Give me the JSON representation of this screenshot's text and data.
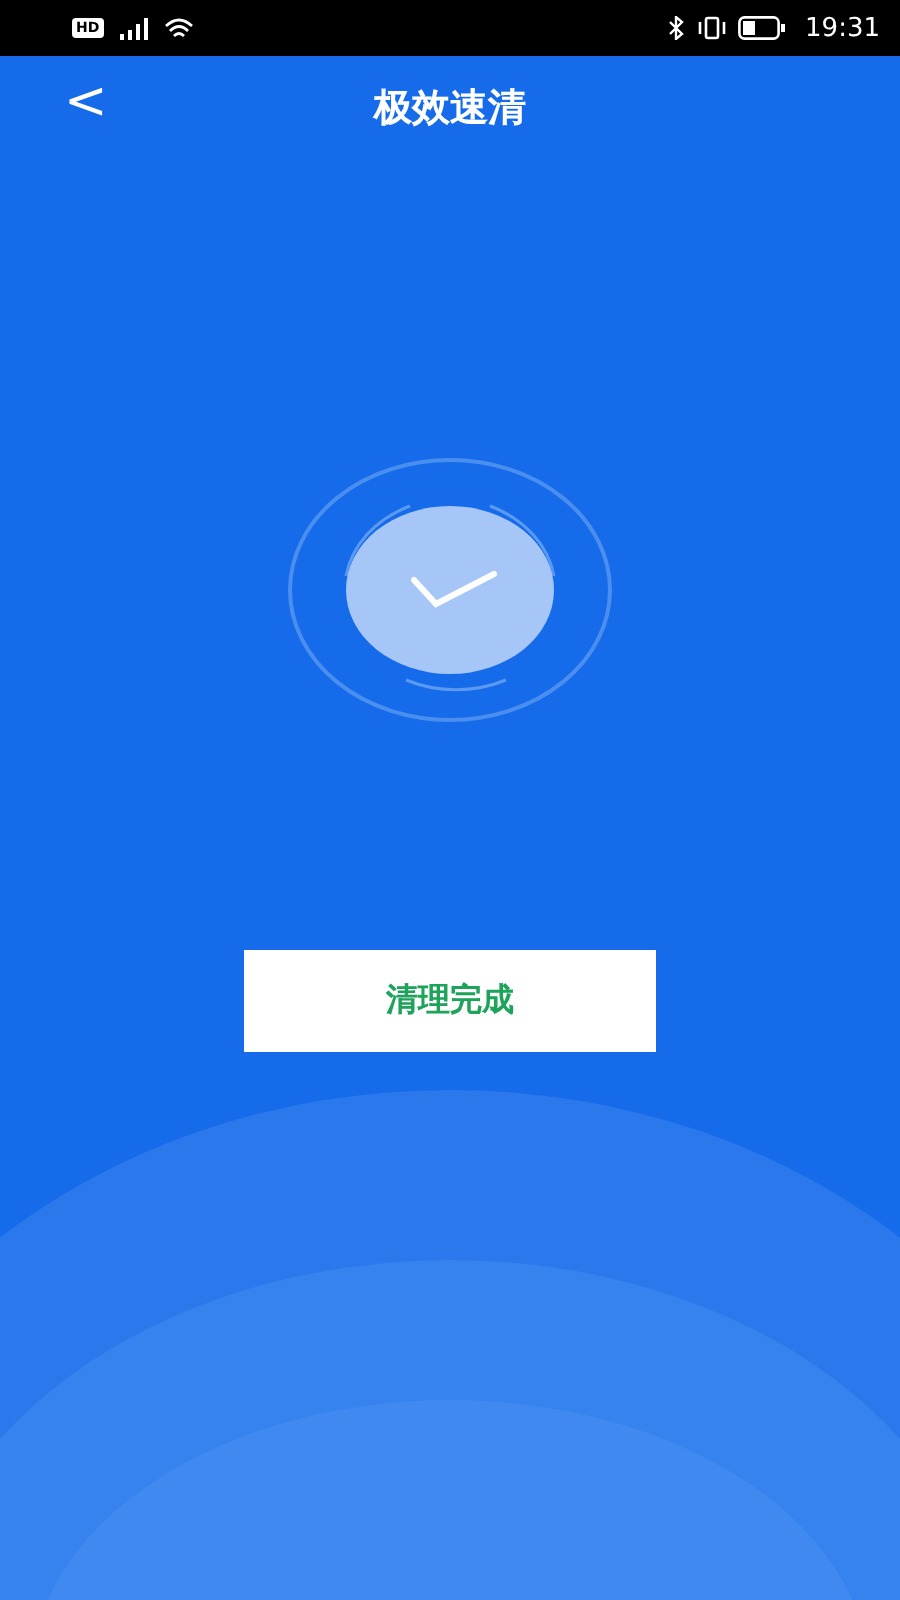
{
  "status_bar": {
    "hd_badge": "HD",
    "time": "19:31"
  },
  "header": {
    "back": "<",
    "title": "极效速清"
  },
  "result": {
    "button": "清理完成"
  }
}
